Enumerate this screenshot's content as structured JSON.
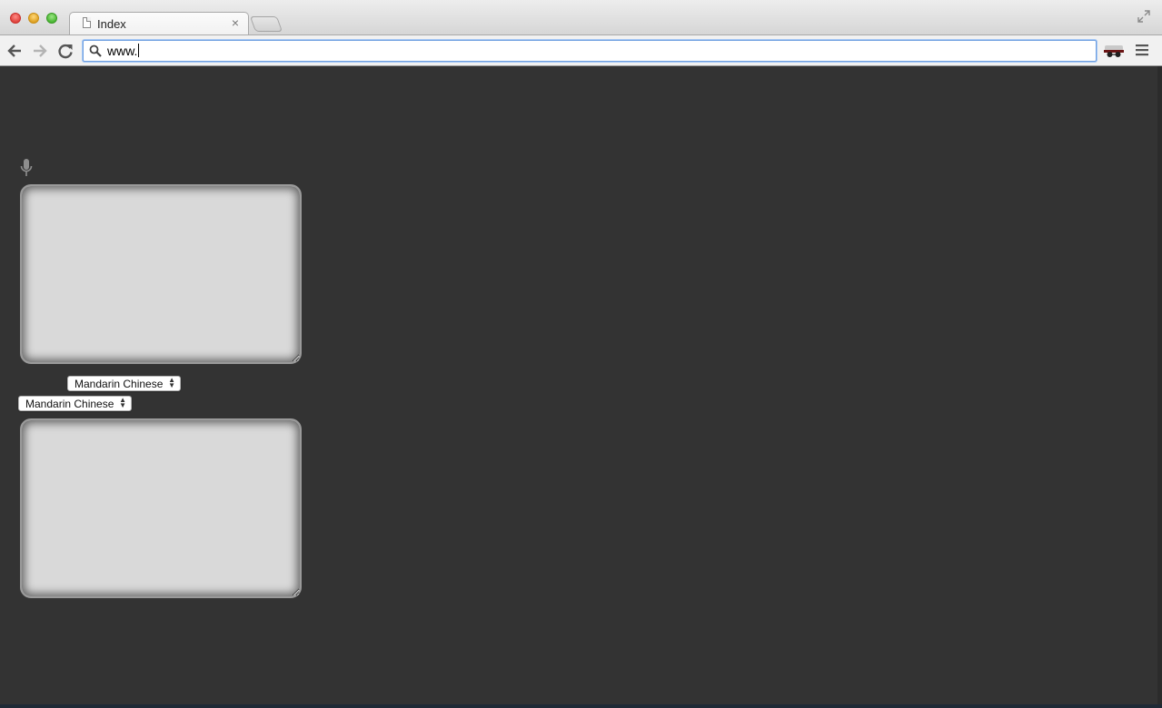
{
  "browser": {
    "tab": {
      "title": "Index",
      "close_label": "×"
    },
    "omnibox": {
      "value": "www."
    }
  },
  "page": {
    "source_language": "Mandarin Chinese",
    "target_language": "Mandarin Chinese",
    "source_text": "",
    "target_text": "",
    "background_color": "#333333",
    "textbox_color": "#d9d9d9"
  },
  "icons": {
    "window": [
      "close-button",
      "minimize-button",
      "maximize-button",
      "fullscreen-icon"
    ],
    "toolbar": [
      "back-arrow-icon",
      "forward-arrow-icon",
      "reload-icon",
      "search-icon",
      "incognito-icon",
      "menu-icon"
    ],
    "page": [
      "microphone-icon"
    ]
  }
}
